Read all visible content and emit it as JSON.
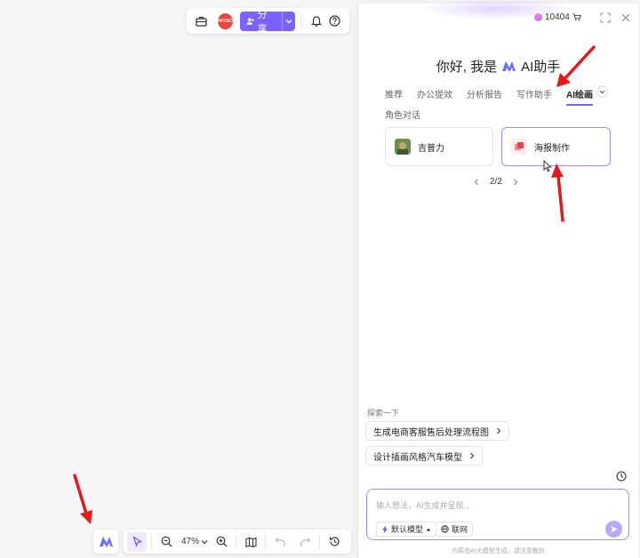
{
  "canvas": {
    "top_toolbar": {
      "toolbox_icon": "toolbox-icon",
      "avatar_label": "HIYISO",
      "share_label": "分享",
      "bell_icon": "bell-icon",
      "help_icon": "help-icon"
    },
    "bottom_toolbar": {
      "zoom_value": "47%"
    }
  },
  "panel": {
    "credits": "10404",
    "greeting_prefix": "你好, 我是",
    "assistant_name": "AI助手",
    "tabs": [
      {
        "label": "推荐",
        "active": false
      },
      {
        "label": "办公提效",
        "active": false
      },
      {
        "label": "分析报告",
        "active": false
      },
      {
        "label": "写作助手",
        "active": false
      },
      {
        "label": "AI绘画",
        "active": true
      }
    ],
    "tab_row2": "角色对话",
    "cards": [
      {
        "label": "吉普力",
        "selected": false
      },
      {
        "label": "海报制作",
        "selected": true
      }
    ],
    "pager": "2/2",
    "explore_title": "探索一下",
    "suggestions": [
      "生成电商客服售后处理流程图",
      "设计插画风格汽车模型"
    ],
    "input_placeholder": "输入想法，AI生成并呈现...",
    "model_chip": "默认模型",
    "web_chip": "联网",
    "disclaimer": "内容由AI大模型生成，请注意甄别"
  },
  "colors": {
    "accent": "#7b61ff",
    "annotation_arrow": "#e3191c"
  }
}
